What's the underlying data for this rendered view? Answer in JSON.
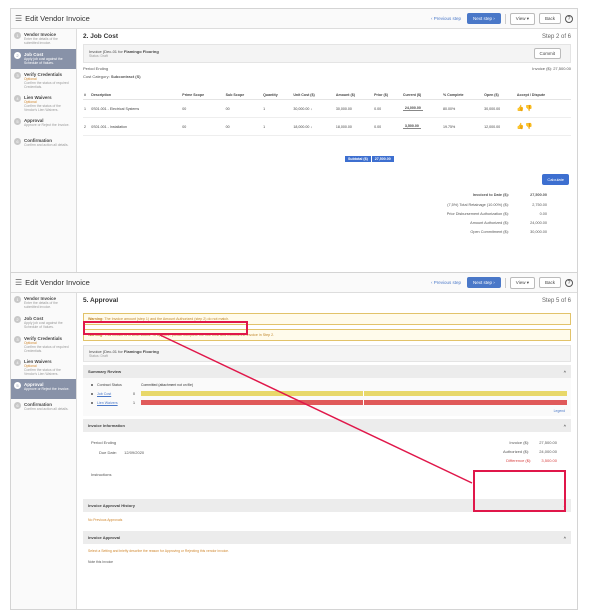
{
  "app": {
    "menu_icon": "menu-icon",
    "title": "Edit Vendor Invoice",
    "prev_step": "‹ Previous step",
    "next_step": "Next step ›",
    "view": "View ▾",
    "back": "Back",
    "help": "?"
  },
  "steps": [
    {
      "n": "1",
      "label": "Vendor Invoice",
      "status": "",
      "desc": "Enter the details of the submitted invoice."
    },
    {
      "n": "2",
      "label": "Job Cost",
      "status": "",
      "desc": "Apply job cost against the Schedule of Values."
    },
    {
      "n": "3",
      "label": "Verify Credentials",
      "status": "Optional",
      "desc": "Confirm the status of required Credentials."
    },
    {
      "n": "4",
      "label": "Lien Waivers",
      "status": "Optional",
      "desc": "Confirm the status of the Vendor's Lien Waivers."
    },
    {
      "n": "5",
      "label": "Approval",
      "status": "",
      "desc": "Approve or Reject the Invoice."
    },
    {
      "n": "6",
      "label": "Confirmation",
      "status": "",
      "desc": "Confirm and action all details."
    }
  ],
  "screen1": {
    "heading": "2. Job Cost",
    "step_no": "Step 2 of 6",
    "vendor_prefix": "Invoice (Dec-01 for",
    "vendor_name": "Flamingo Flooring",
    "status": "Status: Draft",
    "commit": "Commit",
    "period_ending": "Period Ending",
    "invoice_total": "Invoice ($): 27,500.00",
    "cost_category_label": "Cost Category:",
    "cost_category": "Subcontract (S)",
    "columns": [
      "#",
      "Description",
      "Prime Scope",
      "Sub Scope",
      "Quantity",
      "Unit Cost ($)",
      "Amount ($)",
      "Prior ($)",
      "Current ($)",
      "% Complete",
      "Open ($)",
      "Accept / Dispute"
    ],
    "rows": [
      {
        "n": "1",
        "desc": "0S01.001 - Electrical Systems",
        "prime": "00",
        "sub": "00",
        "qty": "1",
        "unit": "30,000.00 ↓",
        "amount": "30,000.00",
        "prior": "0.00",
        "current": "24,000.00",
        "pct": "80.00%",
        "open": "30,000.00"
      },
      {
        "n": "2",
        "desc": "0S01.001 - Installation",
        "prime": "00",
        "sub": "00",
        "qty": "1",
        "unit": "18,000.00 ↓",
        "amount": "18,000.00",
        "prior": "0.00",
        "current": "3,500.00",
        "pct": "19.75%",
        "open": "12,000.00"
      }
    ],
    "subtotal_label": "Subtotal ($)",
    "subtotal_value": "27,500.00",
    "calculate": "Calculate",
    "totals": [
      {
        "k": "Invoiced to Date ($):",
        "v": "27,500.00",
        "bold": true
      },
      {
        "k": "(7,5%) Total Retainage (10.00%) ($):",
        "v": "2,750.00"
      },
      {
        "k": "Prior Disbursement Authorization ($):",
        "v": "0.00"
      },
      {
        "k": "Amount Authorized ($):",
        "v": "24,000.00"
      },
      {
        "k": "Open Commitment ($):",
        "v": "30,000.00"
      }
    ]
  },
  "screen2": {
    "heading": "5. Approval",
    "step_no": "Step 5 of 6",
    "warn1_label": "Warning:",
    "warn1_text": "The Invoice amount (step 1) and the Amount Authorized (step 2) do not match.",
    "warn2_label": "Warning:",
    "warn2_text": "This invoice is in Draft status. To approve, please complete the Job Cost and Commit the Invoice in Step 2.",
    "vendor_prefix": "Invoice (Dec-01 for",
    "vendor_name": "Flamingo Flooring",
    "status": "Status: Draft",
    "summary_title": "Summary Review",
    "contract_status": "Contract Status",
    "committed_label": "Committed (attachment not on file)",
    "bars": [
      {
        "label": "Job Cost",
        "count": "0",
        "color": "#e8d86a",
        "pct": 0.52
      },
      {
        "label": "Lien Waivers",
        "count": "1",
        "color": "#e05a5a",
        "pct": 0.52
      }
    ],
    "legend": "Legend",
    "invoice_info_title": "Invoice Information",
    "period_ending": "Period Ending",
    "due_date_label": "Due Date:",
    "due_date": "12/09/2020",
    "instructions": "Instructions",
    "info_totals": [
      {
        "k": "Invoice ($):",
        "v": "27,500.00"
      },
      {
        "k": "Authorized ($):",
        "v": "24,000.00"
      },
      {
        "k": "Difference ($):",
        "v": "3,500.00",
        "red": true
      }
    ],
    "history_title": "Invoice Approval History",
    "no_history": "No Previous Approvals",
    "approval_title": "Invoice Approval",
    "approval_note": "Select a Setting and briefly describe the reason for Approving or Rejecting this vendor invoice.",
    "note_label": "Note this Invoice"
  },
  "colors": {
    "accent": "#4a78c8",
    "callout": "#e0174a",
    "warning": "#d08830"
  }
}
